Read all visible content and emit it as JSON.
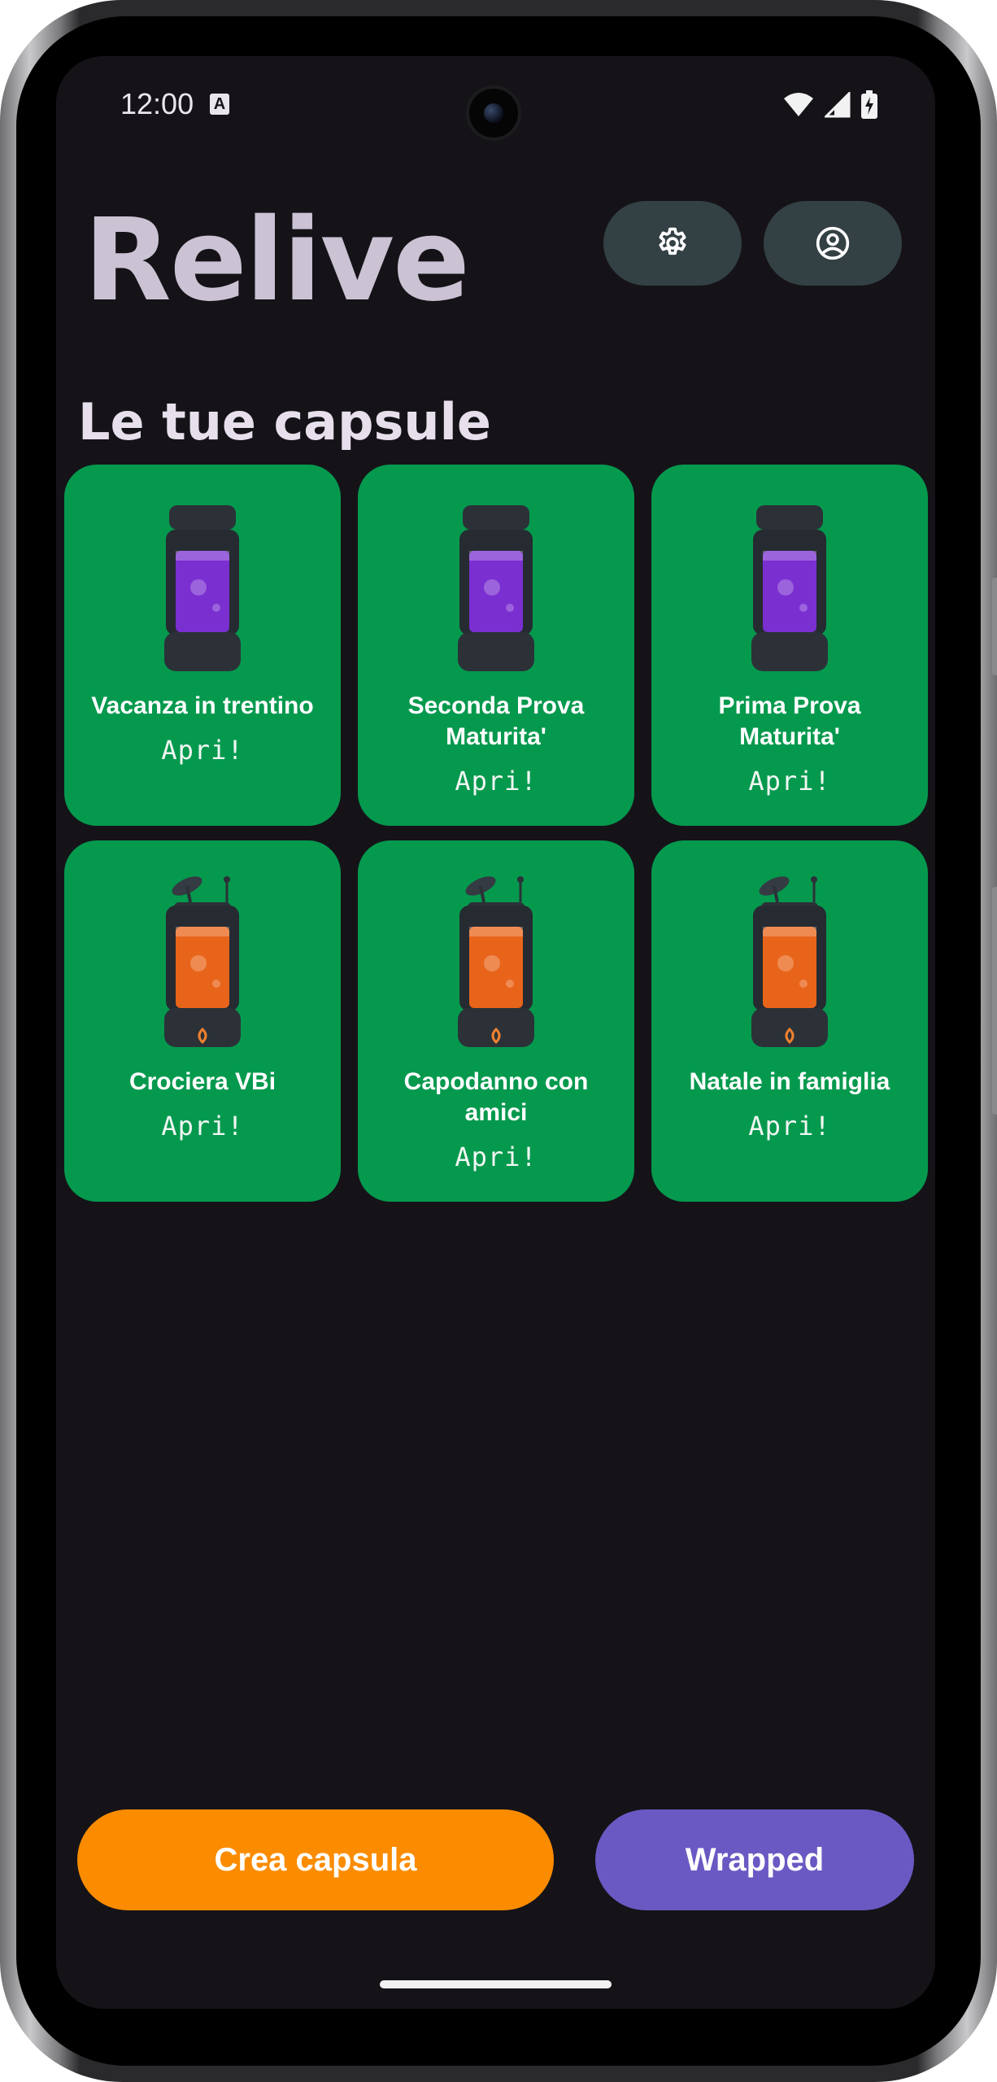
{
  "status_bar": {
    "time": "12:00",
    "notification_badge": "A"
  },
  "header": {
    "title": "Relive",
    "settings_icon": "gear-icon",
    "profile_icon": "account-circle-icon"
  },
  "section": {
    "title": "Le tue capsule"
  },
  "capsules": [
    {
      "name": "Vacanza in trentino",
      "action": "Apri!",
      "state": "closed",
      "color": "#7a2fd0"
    },
    {
      "name": "Seconda Prova Maturita'",
      "action": "Apri!",
      "state": "closed",
      "color": "#7a2fd0"
    },
    {
      "name": "Prima Prova Maturita'",
      "action": "Apri!",
      "state": "closed",
      "color": "#7a2fd0"
    },
    {
      "name": "Crociera VBi",
      "action": "Apri!",
      "state": "open",
      "color": "#e8641a"
    },
    {
      "name": "Capodanno con amici",
      "action": "Apri!",
      "state": "open",
      "color": "#e8641a"
    },
    {
      "name": "Natale in famiglia",
      "action": "Apri!",
      "state": "open",
      "color": "#e8641a"
    }
  ],
  "buttons": {
    "create": "Crea capsula",
    "wrapped": "Wrapped"
  },
  "colors": {
    "background": "#151318",
    "card": "#05994e",
    "create_button": "#fb8c00",
    "wrapped_button": "#6a59c3",
    "icon_button": "#334044",
    "title": "#cbc3d4"
  }
}
